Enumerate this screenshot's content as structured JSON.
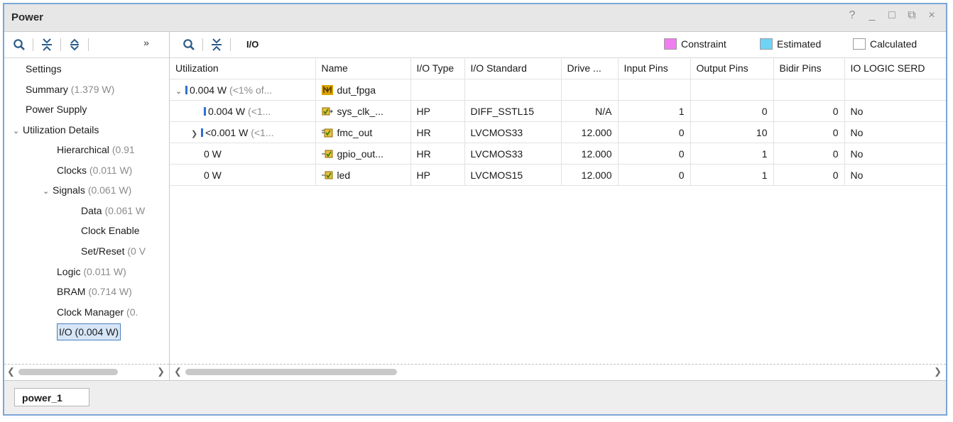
{
  "window": {
    "title": "Power",
    "controls": [
      "?",
      "_",
      "□",
      "⧉",
      "×"
    ]
  },
  "left_toolbar": {
    "icons": [
      "search-icon",
      "collapse-all-icon",
      "expand-all-icon",
      "more-icon"
    ],
    "more_label": "»"
  },
  "nav": {
    "items": [
      {
        "label": "Settings",
        "power": ""
      },
      {
        "label": "Summary",
        "power": "(1.379 W)"
      },
      {
        "label": "Power Supply",
        "power": ""
      },
      {
        "label": "Utilization Details",
        "power": ""
      },
      {
        "label": "Hierarchical",
        "power": "(0.91"
      },
      {
        "label": "Clocks",
        "power": "(0.011 W)"
      },
      {
        "label": "Signals",
        "power": "(0.061 W)"
      },
      {
        "label": "Data",
        "power": "(0.061 W"
      },
      {
        "label": "Clock Enable",
        "power": ""
      },
      {
        "label": "Set/Reset",
        "power": "(0 V"
      },
      {
        "label": "Logic",
        "power": "(0.011 W)"
      },
      {
        "label": "BRAM",
        "power": "(0.714 W)"
      },
      {
        "label": "Clock Manager",
        "power": "(0."
      },
      {
        "label": "I/O (0.004 W)",
        "power": ""
      }
    ]
  },
  "right_toolbar": {
    "section_label": "I/O",
    "legend": [
      {
        "label": "Constraint",
        "color": "#f07ef0"
      },
      {
        "label": "Estimated",
        "color": "#6fd3f5"
      },
      {
        "label": "Calculated",
        "color": "#ffffff"
      }
    ]
  },
  "table": {
    "columns": [
      "Utilization",
      "Name",
      "I/O Type",
      "I/O Standard",
      "Drive ...",
      "Input Pins",
      "Output Pins",
      "Bidir Pins",
      "IO LOGIC SERD"
    ],
    "rows": [
      {
        "util_value": "0.004 W",
        "util_pct": "(<1% of...",
        "name": "dut_fpga",
        "io_type": "",
        "io_standard": "",
        "drive": "",
        "input_pins": "",
        "output_pins": "",
        "bidir_pins": "",
        "io_logic": ""
      },
      {
        "util_value": "0.004 W",
        "util_pct": "(<1...",
        "name": "sys_clk_...",
        "io_type": "HP",
        "io_standard": "DIFF_SSTL15",
        "drive": "N/A",
        "input_pins": "1",
        "output_pins": "0",
        "bidir_pins": "0",
        "io_logic": "No"
      },
      {
        "util_value": "<0.001 W",
        "util_pct": "(<1...",
        "name": "fmc_out",
        "io_type": "HR",
        "io_standard": "LVCMOS33",
        "drive": "12.000",
        "input_pins": "0",
        "output_pins": "10",
        "bidir_pins": "0",
        "io_logic": "No"
      },
      {
        "util_value": "0 W",
        "util_pct": "",
        "name": "gpio_out...",
        "io_type": "HR",
        "io_standard": "LVCMOS33",
        "drive": "12.000",
        "input_pins": "0",
        "output_pins": "1",
        "bidir_pins": "0",
        "io_logic": "No"
      },
      {
        "util_value": "0 W",
        "util_pct": "",
        "name": "led",
        "io_type": "HP",
        "io_standard": "LVCMOS15",
        "drive": "12.000",
        "input_pins": "0",
        "output_pins": "1",
        "bidir_pins": "0",
        "io_logic": "No"
      }
    ]
  },
  "bottom_tabs": [
    "power_1"
  ]
}
